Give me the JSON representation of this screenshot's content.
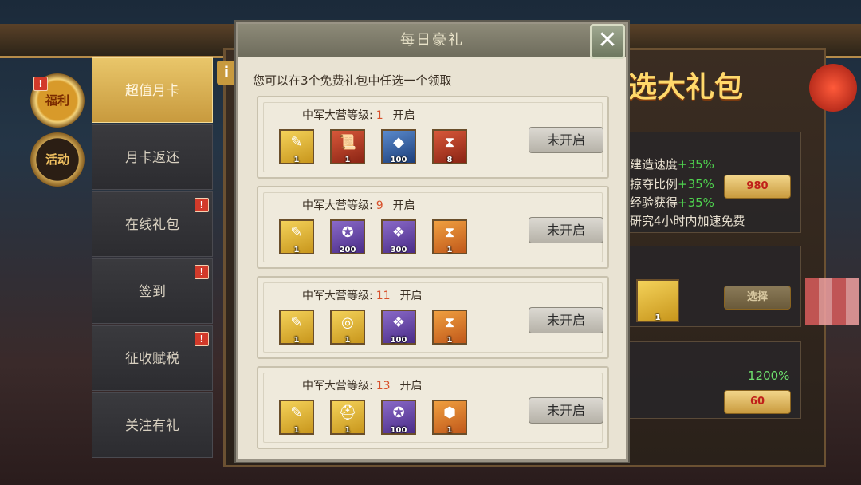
{
  "background": {
    "title": "选大礼包",
    "stats": [
      {
        "label": "建造速度",
        "value": "+35%"
      },
      {
        "label": "掠夺比例",
        "value": "+35%"
      },
      {
        "label": "经验获得",
        "value": "+35%"
      }
    ],
    "research_note": "研究4小时内加速免费",
    "price_1": "980",
    "select_label": "选择",
    "item_qty": "1",
    "percent": "1200%",
    "price_2": "60"
  },
  "side_buttons": [
    {
      "label": "福利",
      "badge": "!"
    },
    {
      "label": "活动"
    }
  ],
  "tabs": [
    {
      "label": "超值月卡"
    },
    {
      "label": "月卡返还"
    },
    {
      "label": "在线礼包",
      "badge": "!"
    },
    {
      "label": "签到",
      "badge": "!"
    },
    {
      "label": "征收赋税",
      "badge": "!"
    },
    {
      "label": "关注有礼"
    }
  ],
  "info_tab": "i",
  "dialog": {
    "title": "每日豪礼",
    "close": "✕",
    "description": "您可以在3个免费礼包中任选一个领取",
    "level_label": "中军大营等级:",
    "open_label": "开启",
    "cards": [
      {
        "level": "1",
        "button": "未开启",
        "items": [
          {
            "icon": "scroll-icon",
            "glyph": "✎",
            "qty": "1",
            "color": "gold"
          },
          {
            "icon": "scroll-red-icon",
            "glyph": "📜",
            "qty": "1",
            "color": "red"
          },
          {
            "icon": "gem-icon",
            "glyph": "◆",
            "qty": "100",
            "color": "blue"
          },
          {
            "icon": "hourglass-icon",
            "glyph": "⧗",
            "qty": "8",
            "color": "red"
          }
        ]
      },
      {
        "level": "9",
        "button": "未开启",
        "items": [
          {
            "icon": "scroll-icon",
            "glyph": "✎",
            "qty": "1",
            "color": "gold"
          },
          {
            "icon": "shield-badge-icon",
            "glyph": "✪",
            "qty": "200",
            "color": "purple"
          },
          {
            "icon": "token-icon",
            "glyph": "❖",
            "qty": "300",
            "color": "purple"
          },
          {
            "icon": "hourglass-icon",
            "glyph": "⧗",
            "qty": "1",
            "color": "orange"
          }
        ]
      },
      {
        "level": "11",
        "button": "未开启",
        "items": [
          {
            "icon": "scroll-icon",
            "glyph": "✎",
            "qty": "1",
            "color": "gold"
          },
          {
            "icon": "ring-icon",
            "glyph": "◎",
            "qty": "1",
            "color": "gold"
          },
          {
            "icon": "token-icon",
            "glyph": "❖",
            "qty": "100",
            "color": "purple"
          },
          {
            "icon": "hourglass-icon",
            "glyph": "⧗",
            "qty": "1",
            "color": "orange"
          }
        ]
      },
      {
        "level": "13",
        "button": "未开启",
        "items": [
          {
            "icon": "scroll-icon",
            "glyph": "✎",
            "qty": "1",
            "color": "gold"
          },
          {
            "icon": "helmet-icon",
            "glyph": "⛑",
            "qty": "1",
            "color": "gold"
          },
          {
            "icon": "shield-badge-icon",
            "glyph": "✪",
            "qty": "100",
            "color": "purple"
          },
          {
            "icon": "gold-nugget-icon",
            "glyph": "⬢",
            "qty": "1",
            "color": "orange"
          }
        ]
      }
    ]
  }
}
